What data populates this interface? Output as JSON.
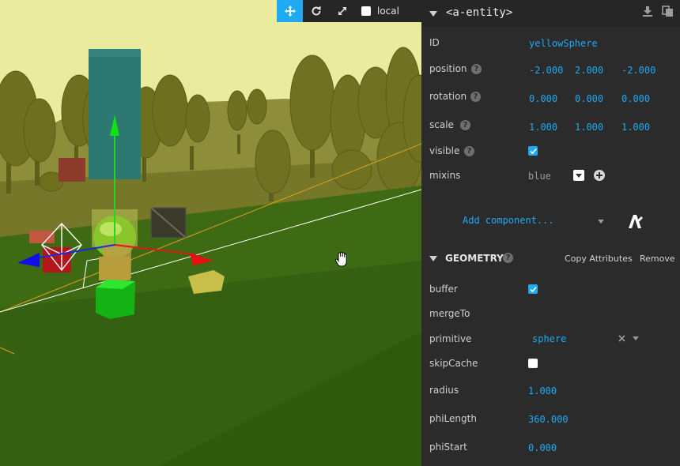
{
  "toolbar": {
    "tools": [
      "translate",
      "rotate",
      "scale"
    ],
    "active_tool": "translate",
    "local_label": "local",
    "local_checked": false
  },
  "inspector": {
    "title": "<a-entity>",
    "id_label": "ID",
    "id_value": "yellowSphere",
    "position": {
      "label": "position",
      "x": "-2.000",
      "y": "2.000",
      "z": "-2.000"
    },
    "rotation": {
      "label": "rotation",
      "x": "0.000",
      "y": "0.000",
      "z": "0.000"
    },
    "scale": {
      "label": "scale",
      "x": "1.000",
      "y": "1.000",
      "z": "1.000"
    },
    "visible": {
      "label": "visible",
      "checked": true
    },
    "mixins": {
      "label": "mixins",
      "value": "blue"
    },
    "add_component_label": "Add component..."
  },
  "geometry": {
    "title": "GEOMETRY",
    "copy_label": "Copy Attributes",
    "remove_label": "Remove",
    "buffer": {
      "label": "buffer",
      "checked": true
    },
    "mergeTo": {
      "label": "mergeTo"
    },
    "primitive": {
      "label": "primitive",
      "value": "sphere"
    },
    "skipCache": {
      "label": "skipCache",
      "checked": false
    },
    "radius": {
      "label": "radius",
      "value": "1.000"
    },
    "phiLength": {
      "label": "phiLength",
      "value": "360.000"
    },
    "phiStart": {
      "label": "phiStart",
      "value": "0.000"
    }
  },
  "colors": {
    "accent": "#1faaf2",
    "panel_bg": "#2b2b2b",
    "ground": "#3f6a14",
    "sky": "#e9eba0"
  },
  "icons": [
    "move-icon",
    "rotate-icon",
    "scale-icon",
    "download-icon",
    "copy-icon",
    "help-icon",
    "aframe-logo-icon",
    "hand-cursor-icon"
  ]
}
